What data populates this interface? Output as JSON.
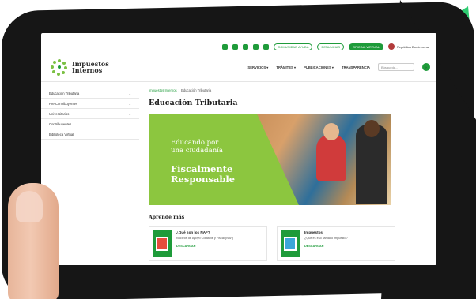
{
  "topbar": {
    "social": [
      "instagram-icon",
      "twitter-icon",
      "facebook-icon",
      "linkedin-icon",
      "youtube-icon"
    ],
    "pills": [
      {
        "label": "COMUNIDAD AYUDA",
        "filled": false
      },
      {
        "label": "DENUNCIAS",
        "filled": false
      },
      {
        "label": "OFICINA VIRTUAL",
        "filled": true
      }
    ],
    "gov_label": "República Dominicana"
  },
  "header": {
    "logo_line1": "Impuestos",
    "logo_line2": "Internos",
    "nav": [
      "SERVICIOS ▾",
      "TRÁMITES ▾",
      "PUBLICACIONES ▾",
      "TRANSPARENCIA"
    ],
    "search_placeholder": "Búsqueda..."
  },
  "sidebar": {
    "items": [
      {
        "label": "Educación Tributaria",
        "chevron": "⌄"
      },
      {
        "label": "Pre-Contribuyentes",
        "chevron": "⌄"
      },
      {
        "label": "Universitarios",
        "chevron": "⌄"
      },
      {
        "label": "Contribuyentes",
        "chevron": "⌄"
      },
      {
        "label": "Biblioteca Virtual",
        "chevron": ""
      }
    ]
  },
  "main": {
    "breadcrumb_root": "Impuestos Internos",
    "breadcrumb_current": "Educación Tributaria",
    "title": "Educación Tributaria",
    "banner_line1": "Educando por",
    "banner_line2": "una ciudadanía",
    "banner_line3": "Fiscalmente",
    "banner_line4": "Responsable",
    "section_title": "Aprende más",
    "cards": [
      {
        "title": "¿Qué son los NAF?",
        "desc": "Núcleos de Apoyo Contable y Fiscal (NAF)",
        "link": "DESCARGAR"
      },
      {
        "title": "Impuestos",
        "desc": "¿Qué es eso llamado impuesto?",
        "link": "DESCARGAR"
      }
    ]
  },
  "colors": {
    "brand_green": "#1e9b3a",
    "banner_green": "#8cc63f",
    "tablet_black": "#161616"
  }
}
